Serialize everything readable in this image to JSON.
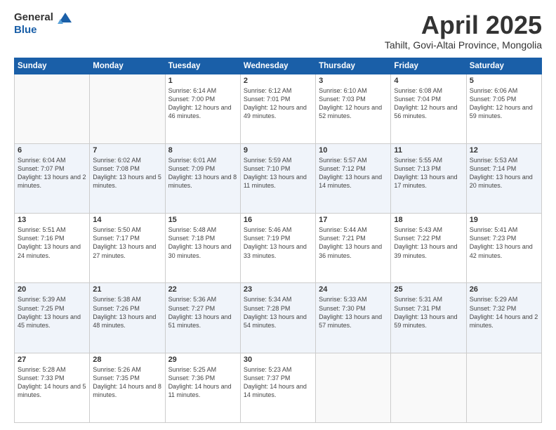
{
  "header": {
    "logo_line1": "General",
    "logo_line2": "Blue",
    "month": "April 2025",
    "location": "Tahilt, Govi-Altai Province, Mongolia"
  },
  "weekdays": [
    "Sunday",
    "Monday",
    "Tuesday",
    "Wednesday",
    "Thursday",
    "Friday",
    "Saturday"
  ],
  "weeks": [
    [
      {
        "day": "",
        "info": ""
      },
      {
        "day": "",
        "info": ""
      },
      {
        "day": "1",
        "info": "Sunrise: 6:14 AM\nSunset: 7:00 PM\nDaylight: 12 hours and 46 minutes."
      },
      {
        "day": "2",
        "info": "Sunrise: 6:12 AM\nSunset: 7:01 PM\nDaylight: 12 hours and 49 minutes."
      },
      {
        "day": "3",
        "info": "Sunrise: 6:10 AM\nSunset: 7:03 PM\nDaylight: 12 hours and 52 minutes."
      },
      {
        "day": "4",
        "info": "Sunrise: 6:08 AM\nSunset: 7:04 PM\nDaylight: 12 hours and 56 minutes."
      },
      {
        "day": "5",
        "info": "Sunrise: 6:06 AM\nSunset: 7:05 PM\nDaylight: 12 hours and 59 minutes."
      }
    ],
    [
      {
        "day": "6",
        "info": "Sunrise: 6:04 AM\nSunset: 7:07 PM\nDaylight: 13 hours and 2 minutes."
      },
      {
        "day": "7",
        "info": "Sunrise: 6:02 AM\nSunset: 7:08 PM\nDaylight: 13 hours and 5 minutes."
      },
      {
        "day": "8",
        "info": "Sunrise: 6:01 AM\nSunset: 7:09 PM\nDaylight: 13 hours and 8 minutes."
      },
      {
        "day": "9",
        "info": "Sunrise: 5:59 AM\nSunset: 7:10 PM\nDaylight: 13 hours and 11 minutes."
      },
      {
        "day": "10",
        "info": "Sunrise: 5:57 AM\nSunset: 7:12 PM\nDaylight: 13 hours and 14 minutes."
      },
      {
        "day": "11",
        "info": "Sunrise: 5:55 AM\nSunset: 7:13 PM\nDaylight: 13 hours and 17 minutes."
      },
      {
        "day": "12",
        "info": "Sunrise: 5:53 AM\nSunset: 7:14 PM\nDaylight: 13 hours and 20 minutes."
      }
    ],
    [
      {
        "day": "13",
        "info": "Sunrise: 5:51 AM\nSunset: 7:16 PM\nDaylight: 13 hours and 24 minutes."
      },
      {
        "day": "14",
        "info": "Sunrise: 5:50 AM\nSunset: 7:17 PM\nDaylight: 13 hours and 27 minutes."
      },
      {
        "day": "15",
        "info": "Sunrise: 5:48 AM\nSunset: 7:18 PM\nDaylight: 13 hours and 30 minutes."
      },
      {
        "day": "16",
        "info": "Sunrise: 5:46 AM\nSunset: 7:19 PM\nDaylight: 13 hours and 33 minutes."
      },
      {
        "day": "17",
        "info": "Sunrise: 5:44 AM\nSunset: 7:21 PM\nDaylight: 13 hours and 36 minutes."
      },
      {
        "day": "18",
        "info": "Sunrise: 5:43 AM\nSunset: 7:22 PM\nDaylight: 13 hours and 39 minutes."
      },
      {
        "day": "19",
        "info": "Sunrise: 5:41 AM\nSunset: 7:23 PM\nDaylight: 13 hours and 42 minutes."
      }
    ],
    [
      {
        "day": "20",
        "info": "Sunrise: 5:39 AM\nSunset: 7:25 PM\nDaylight: 13 hours and 45 minutes."
      },
      {
        "day": "21",
        "info": "Sunrise: 5:38 AM\nSunset: 7:26 PM\nDaylight: 13 hours and 48 minutes."
      },
      {
        "day": "22",
        "info": "Sunrise: 5:36 AM\nSunset: 7:27 PM\nDaylight: 13 hours and 51 minutes."
      },
      {
        "day": "23",
        "info": "Sunrise: 5:34 AM\nSunset: 7:28 PM\nDaylight: 13 hours and 54 minutes."
      },
      {
        "day": "24",
        "info": "Sunrise: 5:33 AM\nSunset: 7:30 PM\nDaylight: 13 hours and 57 minutes."
      },
      {
        "day": "25",
        "info": "Sunrise: 5:31 AM\nSunset: 7:31 PM\nDaylight: 13 hours and 59 minutes."
      },
      {
        "day": "26",
        "info": "Sunrise: 5:29 AM\nSunset: 7:32 PM\nDaylight: 14 hours and 2 minutes."
      }
    ],
    [
      {
        "day": "27",
        "info": "Sunrise: 5:28 AM\nSunset: 7:33 PM\nDaylight: 14 hours and 5 minutes."
      },
      {
        "day": "28",
        "info": "Sunrise: 5:26 AM\nSunset: 7:35 PM\nDaylight: 14 hours and 8 minutes."
      },
      {
        "day": "29",
        "info": "Sunrise: 5:25 AM\nSunset: 7:36 PM\nDaylight: 14 hours and 11 minutes."
      },
      {
        "day": "30",
        "info": "Sunrise: 5:23 AM\nSunset: 7:37 PM\nDaylight: 14 hours and 14 minutes."
      },
      {
        "day": "",
        "info": ""
      },
      {
        "day": "",
        "info": ""
      },
      {
        "day": "",
        "info": ""
      }
    ]
  ]
}
